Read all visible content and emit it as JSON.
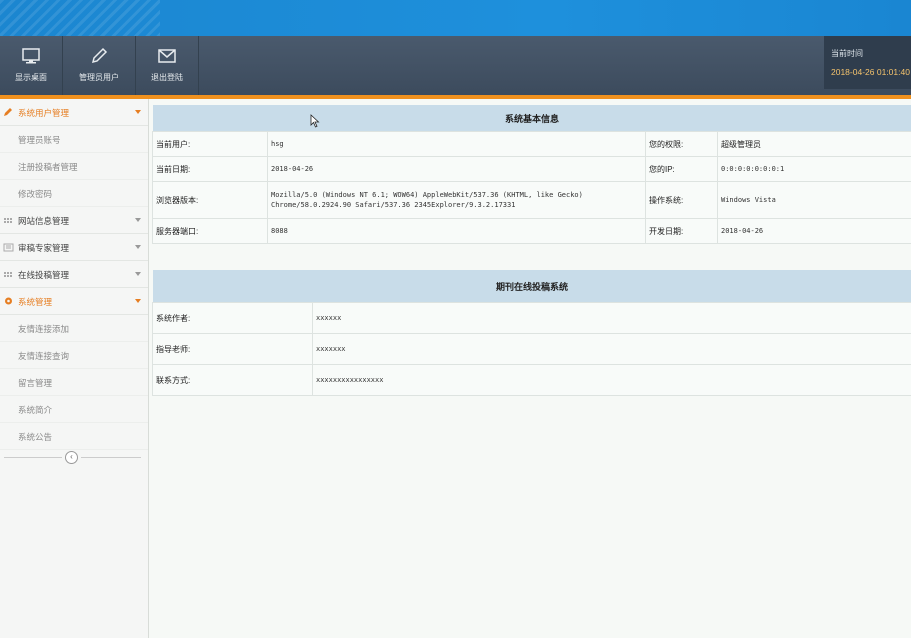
{
  "toolbar": {
    "buttons": [
      {
        "label": "显示桌面",
        "icon": "monitor-icon"
      },
      {
        "label": "管理员用户",
        "icon": "pencil-icon"
      },
      {
        "label": "退出登陆",
        "icon": "envelope-icon"
      }
    ],
    "time_label": "当前时间",
    "time_value": "2018-04-26 01:01:40"
  },
  "sidebar": {
    "sections": [
      {
        "label": "系统用户管理",
        "icon": "pencil-icon",
        "active": true,
        "items": [
          "管理员账号",
          "注册投稿者管理",
          "修改密码"
        ]
      },
      {
        "label": "网站信息管理",
        "icon": "grid-icon",
        "active": false,
        "items": []
      },
      {
        "label": "审稿专家管理",
        "icon": "list-icon",
        "active": false,
        "items": []
      },
      {
        "label": "在线投稿管理",
        "icon": "grid-icon",
        "active": false,
        "items": []
      },
      {
        "label": "系统管理",
        "icon": "gear-icon",
        "active": true,
        "items": [
          "友情连接添加",
          "友情连接查询",
          "留言管理",
          "系统简介",
          "系统公告"
        ]
      }
    ],
    "collapse_glyph": "‹"
  },
  "info": {
    "title": "系统基本信息",
    "rows": [
      {
        "l1": "当前用户:",
        "v1": "hsg",
        "l2": "您的权限:",
        "v2": "超级管理员"
      },
      {
        "l1": "当前日期:",
        "v1": "2018-04-26",
        "l2": "您的IP:",
        "v2": "0:0:0:0:0:0:0:1"
      },
      {
        "l1": "浏览器版本:",
        "v1": "Mozilla/5.0 (Windows NT 6.1; WOW64) AppleWebKit/537.36 (KHTML, like Gecko) Chrome/58.0.2924.90 Safari/537.36 2345Explorer/9.3.2.17331",
        "l2": "操作系统:",
        "v2": "Windows Vista"
      },
      {
        "l1": "服务器端口:",
        "v1": "8088",
        "l2": "开发日期:",
        "v2": "2018-04-26"
      }
    ]
  },
  "system": {
    "title": "期刊在线投稿系统",
    "rows": [
      {
        "label": "系统作者:",
        "value": "xxxxxx"
      },
      {
        "label": "指导老师:",
        "value": "xxxxxxx"
      },
      {
        "label": "联系方式:",
        "value": "xxxxxxxxxxxxxxxx"
      }
    ]
  },
  "colors": {
    "header_blue": "#1e90dc",
    "toolbar": "#3f4e60",
    "accent_orange": "#f0911e",
    "table_head": "#c8dce9"
  }
}
